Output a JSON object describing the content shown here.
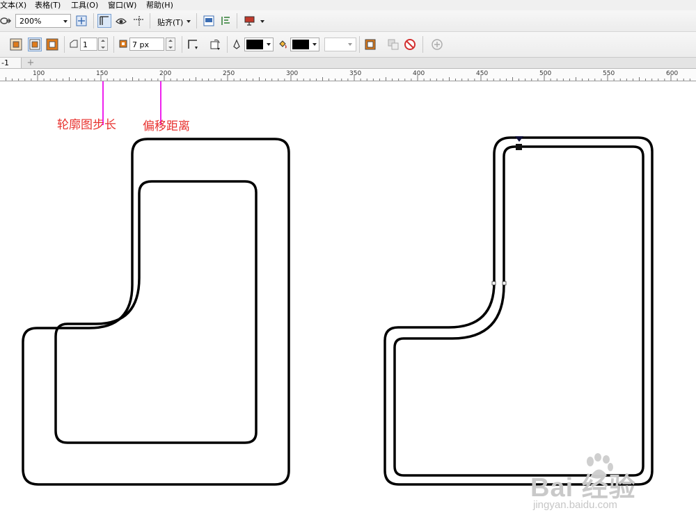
{
  "menu": {
    "items": [
      "文本(X)",
      "表格(T)",
      "工具(O)",
      "窗口(W)",
      "帮助(H)"
    ]
  },
  "toolbar1": {
    "zoom_value": "200%",
    "snap_label": "贴齐(T)"
  },
  "toolbar2": {
    "contour_steps_value": "1",
    "contour_offset_value": "7 px"
  },
  "tabs": {
    "doc_tab_label": "-1",
    "add_tab_symbol": "+"
  },
  "ruler": {
    "labels": [
      "100",
      "150",
      "200",
      "250",
      "300",
      "350",
      "400",
      "450",
      "500",
      "550",
      "600"
    ]
  },
  "annotations": {
    "steps_label": "轮廓图步长",
    "offset_label": "偏移距离"
  },
  "colors": {
    "annotation_text": "#e8332f",
    "arrow": "#ee22ee",
    "shape_stroke": "#000000"
  },
  "watermark": {
    "brand_text": "Bai 经验",
    "url_text": "jingyan.baidu.com"
  }
}
